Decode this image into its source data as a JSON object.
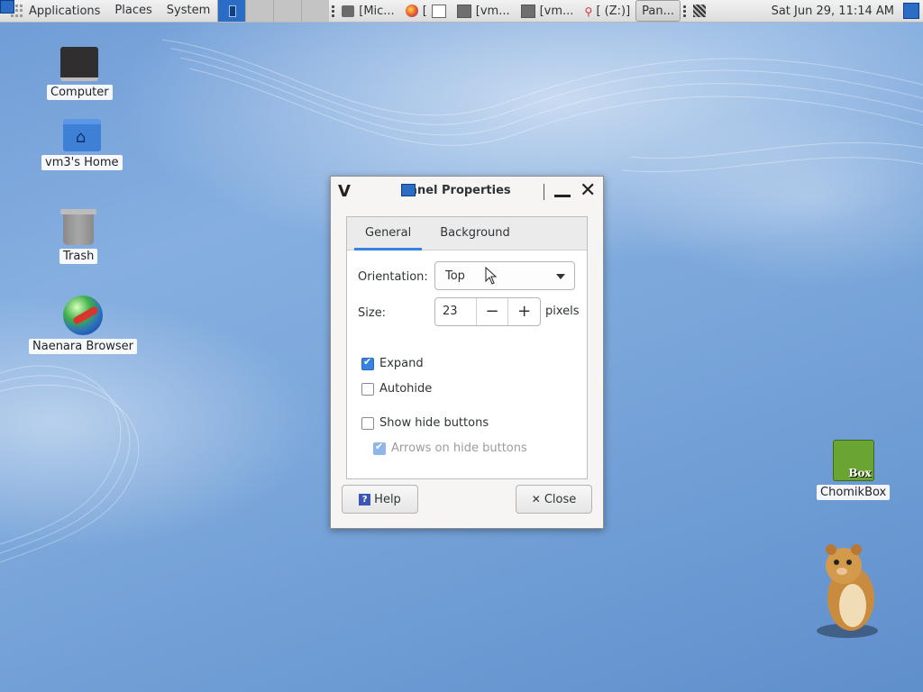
{
  "panel": {
    "apps_label": "Applications",
    "places_label": "Places",
    "system_label": "System",
    "tasks": [
      {
        "label": "[Mic...",
        "icon": "folder-icon"
      },
      {
        "label": "[",
        "icon": "browser-icon"
      },
      {
        "label": "[vm...",
        "icon": "terminal-icon"
      },
      {
        "label": "[vm...",
        "icon": "terminal-icon"
      },
      {
        "label": "[ (Z:)]",
        "icon": "pin-icon"
      },
      {
        "label": "Pan...",
        "icon": "panel-icon"
      }
    ],
    "clock": "Sat Jun 29, 11:14 AM"
  },
  "desktop": {
    "computer": "Computer",
    "home": "vm3's Home",
    "trash": "Trash",
    "browser": "Naenara Browser",
    "chomikbox": "ChomikBox",
    "chomikbox_badge": "Box"
  },
  "dialog": {
    "title": "Panel Properties",
    "tabs": [
      "General",
      "Background"
    ],
    "orientation_label": "Orientation:",
    "orientation_value": "Top",
    "size_label": "Size:",
    "size_value": "23",
    "size_unit": "pixels",
    "expand_label": "Expand",
    "expand_checked": true,
    "autohide_label": "Autohide",
    "autohide_checked": false,
    "show_hide_label": "Show hide buttons",
    "show_hide_checked": false,
    "arrows_label": "Arrows on hide buttons",
    "arrows_checked": true,
    "help_button": "Help",
    "close_button": "Close"
  },
  "colors": {
    "accent": "#3584e4",
    "workspace_active": "#2b6cc4"
  }
}
